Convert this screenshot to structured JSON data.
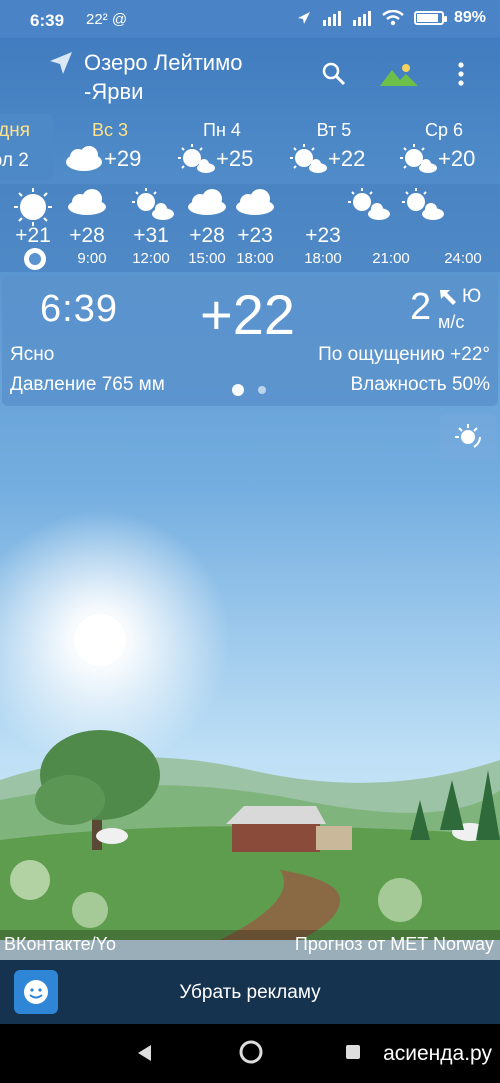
{
  "status_bar": {
    "time": "6:39",
    "left_extra": "22² @",
    "battery_text": "89%",
    "battery_level": 0.89
  },
  "header": {
    "city_line1": "Озеро Лейтимо",
    "city_line2": "-Ярви",
    "icons": [
      "location-arrow-icon",
      "search-icon",
      "landscape-icon",
      "more-vert-icon"
    ]
  },
  "daily": {
    "today_line1": "одня",
    "today_line2": "юл 2",
    "days": [
      {
        "label": "Вс 3",
        "temp": "+29",
        "icon": "partly-cloudy-icon",
        "weekend": true
      },
      {
        "label": "Пн 4",
        "temp": "+25",
        "icon": "sun-cloud-icon",
        "weekend": false
      },
      {
        "label": "Вт 5",
        "temp": "+22",
        "icon": "sun-cloud-icon",
        "weekend": false
      },
      {
        "label": "Ср 6",
        "temp": "+20",
        "icon": "sun-cloud-icon",
        "weekend": false
      }
    ]
  },
  "hourly": [
    {
      "temp": "+21",
      "hour": "",
      "icon": "sun-icon"
    },
    {
      "temp": "+28",
      "hour": "9:00",
      "icon": "cloud-icon"
    },
    {
      "temp": "+31",
      "hour": "12:00",
      "icon": "sun-cloud-icon"
    },
    {
      "temp": "+28",
      "hour": "15:00",
      "icon": "cloud-icon"
    },
    {
      "temp": "+23",
      "hour": "18:00",
      "icon": "cloud-icon"
    },
    {
      "temp": "",
      "hour": "21:00",
      "icon": "sun-cloud-icon"
    },
    {
      "temp": "",
      "hour": "24:00",
      "icon": "sun-cloud-icon"
    }
  ],
  "current": {
    "clock": "6:39",
    "temp": "+22",
    "wind_speed": "2",
    "wind_unit": "м/с",
    "wind_dir": "Ю",
    "condition": "Ясно",
    "feels_like": "По ощущению +22°",
    "pressure": "Давление 765 мм",
    "humidity": "Влажность 50%"
  },
  "credits": {
    "left": "ВКонтакте/Yo",
    "right": "Прогноз от MET Norway"
  },
  "ad": {
    "text": "Убрать рекламу"
  },
  "watermark": "асиенда.ру",
  "colors": {
    "header_bg": "#4a83c6",
    "weekend_label": "#ffe28a",
    "ad_bg": "#15324f"
  }
}
